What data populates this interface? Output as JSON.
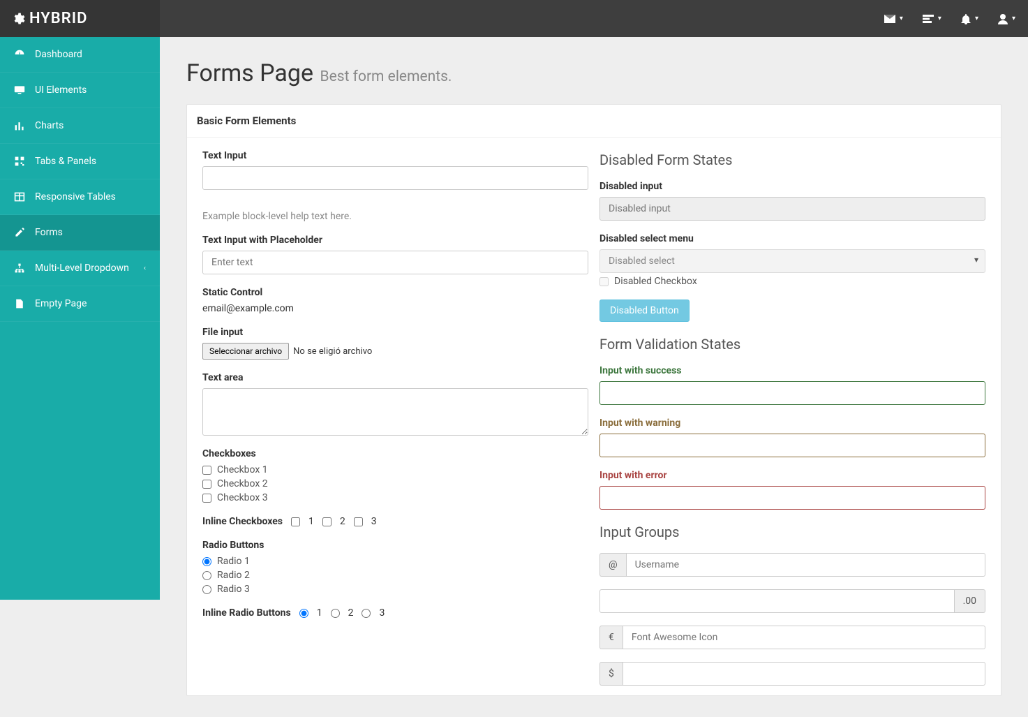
{
  "brand": "HYBRID",
  "sidebar": {
    "items": [
      {
        "label": "Dashboard"
      },
      {
        "label": "UI Elements"
      },
      {
        "label": "Charts"
      },
      {
        "label": "Tabs & Panels"
      },
      {
        "label": "Responsive Tables"
      },
      {
        "label": "Forms"
      },
      {
        "label": "Multi-Level Dropdown"
      },
      {
        "label": "Empty Page"
      }
    ]
  },
  "page": {
    "title": "Forms Page",
    "subtitle": "Best form elements."
  },
  "panel": {
    "title": "Basic Form Elements"
  },
  "left": {
    "text_input_label": "Text Input",
    "help_text": "Example block-level help text here.",
    "placeholder_label": "Text Input with Placeholder",
    "placeholder_value": "Enter text",
    "static_label": "Static Control",
    "static_value": "email@example.com",
    "file_label": "File input",
    "file_button": "Seleccionar archivo",
    "file_status": "No se eligió archivo",
    "textarea_label": "Text area",
    "checkboxes_label": "Checkboxes",
    "checkboxes": [
      "Checkbox 1",
      "Checkbox 2",
      "Checkbox 3"
    ],
    "inline_checkboxes_label": "Inline Checkboxes",
    "inline_checkboxes": [
      "1",
      "2",
      "3"
    ],
    "radios_label": "Radio Buttons",
    "radios": [
      "Radio 1",
      "Radio 2",
      "Radio 3"
    ],
    "inline_radios_label": "Inline Radio Buttons",
    "inline_radios": [
      "1",
      "2",
      "3"
    ]
  },
  "right": {
    "disabled_section": "Disabled Form States",
    "disabled_input_label": "Disabled input",
    "disabled_input_placeholder": "Disabled input",
    "disabled_select_label": "Disabled select menu",
    "disabled_select_value": "Disabled select",
    "disabled_checkbox": "Disabled Checkbox",
    "disabled_button": "Disabled Button",
    "validation_section": "Form Validation States",
    "success_label": "Input with success",
    "warning_label": "Input with warning",
    "error_label": "Input with error",
    "groups_section": "Input Groups",
    "group_at": "@",
    "group_username_placeholder": "Username",
    "group_suffix": ".00",
    "group_euro": "€",
    "group_fa_placeholder": "Font Awesome Icon",
    "group_dollar": "$"
  }
}
